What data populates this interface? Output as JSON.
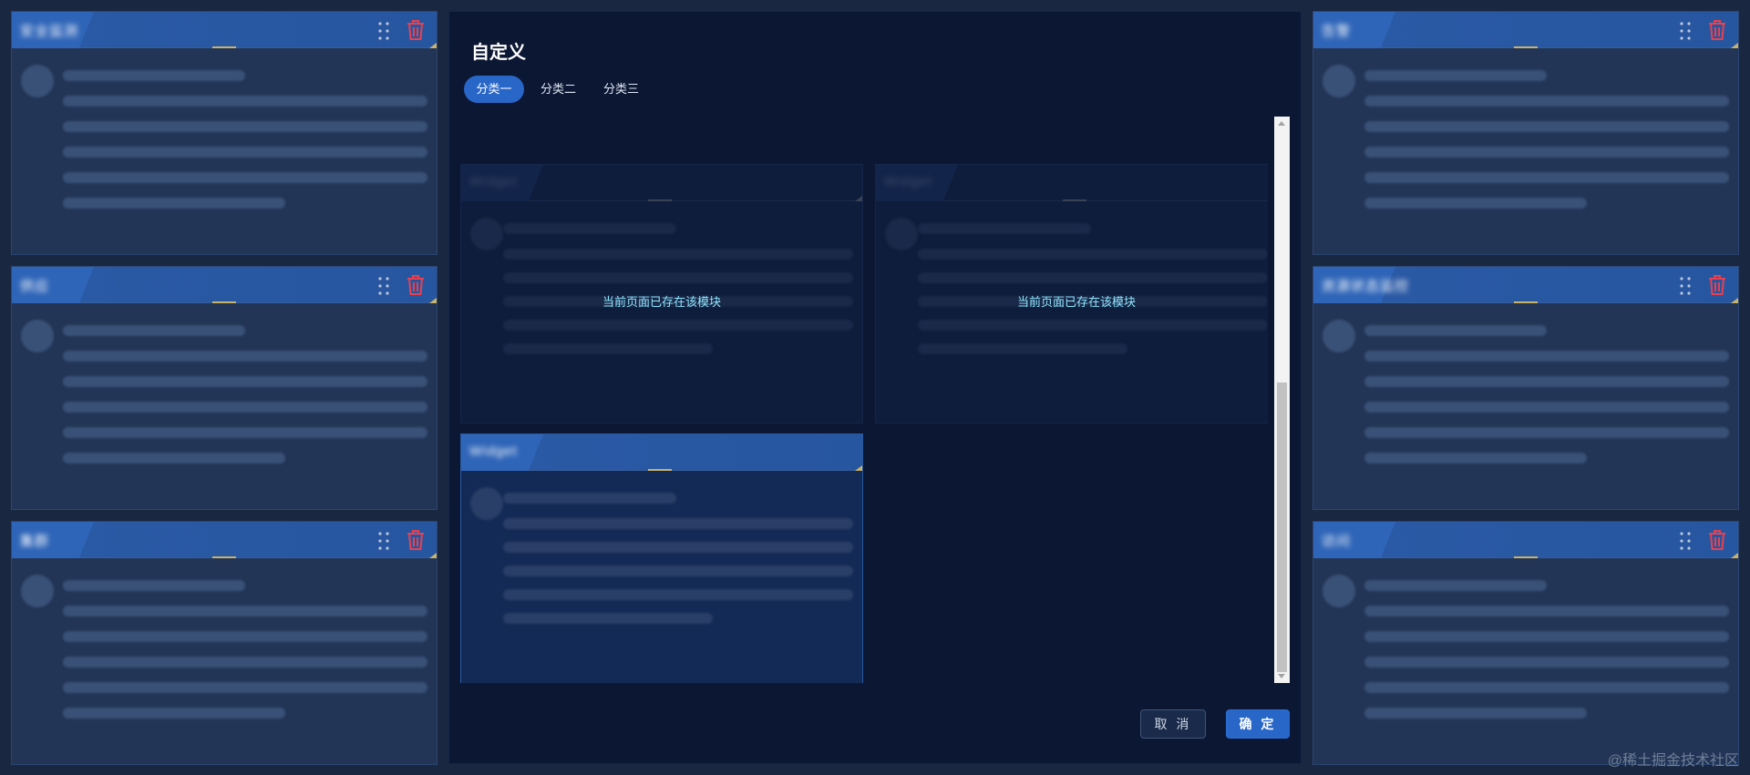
{
  "modal": {
    "title": "自定义",
    "tabs": [
      {
        "label": "分类一",
        "active": true
      },
      {
        "label": "分类二",
        "active": false
      },
      {
        "label": "分类三",
        "active": false
      }
    ],
    "cards": [
      {
        "title": "Widget",
        "state": "exists",
        "notice": "当前页面已存在该模块"
      },
      {
        "title": "Widget",
        "state": "exists",
        "notice": "当前页面已存在该模块"
      },
      {
        "title": "Widget",
        "state": "available",
        "notice": ""
      }
    ],
    "cancel_label": "取 消",
    "confirm_label": "确 定"
  },
  "left_cards": [
    {
      "title": "安全监测"
    },
    {
      "title": "供应"
    },
    {
      "title": "集群"
    }
  ],
  "right_cards": [
    {
      "title": "告警"
    },
    {
      "title": "资源状态监控"
    },
    {
      "title": "访问"
    }
  ],
  "icons": {
    "drag": "drag-handle-icon",
    "delete": "trash-icon"
  },
  "colors": {
    "accent": "#2866c7",
    "delete": "#e8404f",
    "notice": "#8fe6ff"
  },
  "watermark": "@稀土掘金技术社区"
}
